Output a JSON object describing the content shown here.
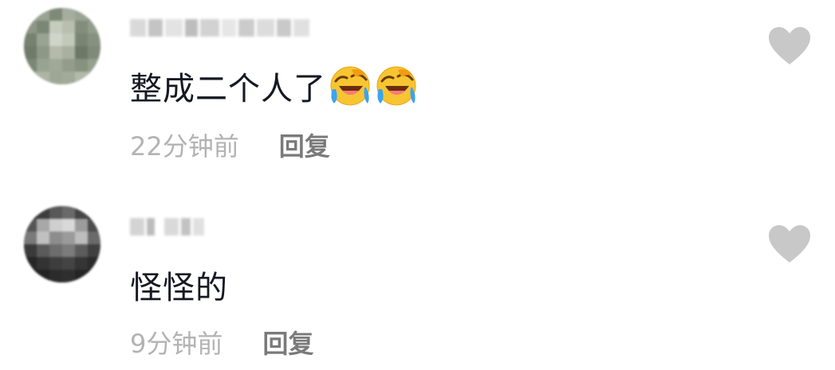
{
  "comments": [
    {
      "text": "整成二个人了",
      "time": "22分钟前",
      "reply_label": "回复",
      "emoji_icon": "laughing-crying-emoji-icon",
      "emoji_count": 2
    },
    {
      "text": "怪怪的",
      "time": "9分钟前",
      "reply_label": "回复"
    }
  ],
  "colors": {
    "text": "#161823",
    "time": "#b3b3b3",
    "reply": "#7a7a7a",
    "heart": "#c8c8c8"
  }
}
